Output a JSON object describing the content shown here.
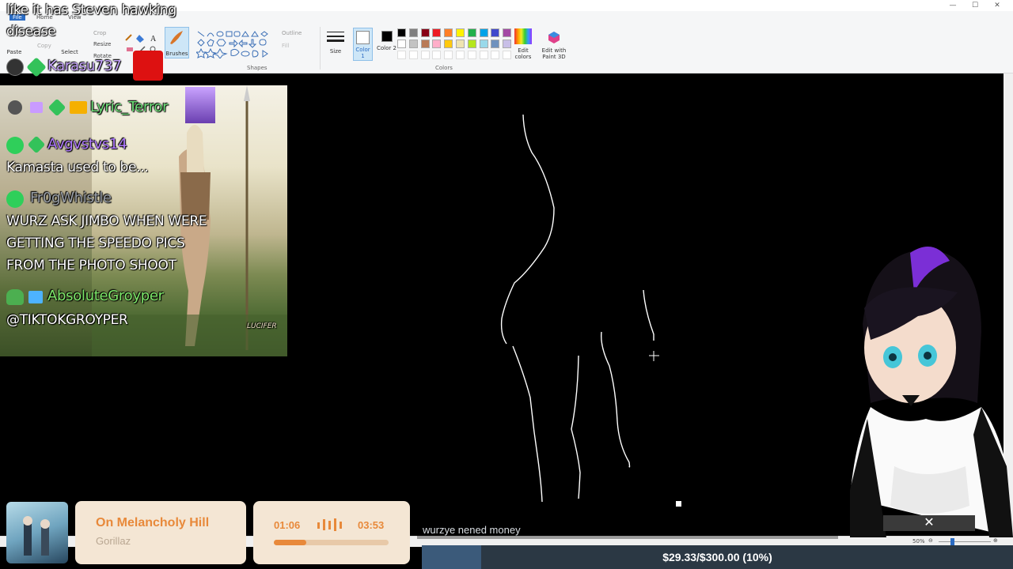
{
  "window": {
    "minimize": "—",
    "maximize": "☐",
    "close": "✕"
  },
  "ribbon": {
    "tab_file": "File",
    "tab_home": "Home",
    "tab_view": "View",
    "paste": "Paste",
    "copy": "Copy",
    "select": "Select",
    "crop": "Crop",
    "resize": "Resize",
    "rotate": "Rotate",
    "brushes": "Brushes",
    "outline": "Outline",
    "fill": "Fill",
    "shapes_group": "Shapes",
    "size": "Size",
    "color1": "Color 1",
    "color2": "Color 2",
    "colors_group": "Colors",
    "edit_colors": "Edit colors",
    "edit_paint3d": "Edit with Paint 3D",
    "palette_row1": [
      "#000000",
      "#7f7f7f",
      "#880015",
      "#ed1c24",
      "#ff7f27",
      "#fff200",
      "#22b14c",
      "#00a2e8",
      "#3f48cc",
      "#a349a4"
    ],
    "palette_row2": [
      "#ffffff",
      "#c3c3c3",
      "#b97a57",
      "#ffaec9",
      "#ffc90e",
      "#efe4b0",
      "#b5e61d",
      "#99d9ea",
      "#7092be",
      "#c8bfe7"
    ]
  },
  "statusbar": {
    "zoom": "50%",
    "zoom_out": "⊖",
    "zoom_in": "⊕"
  },
  "chat": {
    "top_msg_line1": "like it has Steven hawking",
    "top_msg_line2": "disease",
    "user1": "Karasu737",
    "user2": "Lyric_Terror",
    "user3": "Avgvstvs14",
    "msg3": "Kamasta used to be...",
    "user4": "Fr0gWhistle",
    "msg4_line1": "WURZ ASK JIMBO WHEN WERE",
    "msg4_line2": "GETTING THE SPEEDO PICS",
    "msg4_line3": "FROM THE PHOTO SHOOT",
    "user5": "AbsoluteGroyper",
    "msg5": "@TIKTOKGROYPER"
  },
  "art_card": {
    "logo": "LUCIFER"
  },
  "music": {
    "title": "On Melancholy Hill",
    "artist": "Gorillaz",
    "elapsed": "01:06",
    "total": "03:53",
    "progress": 0.28
  },
  "ticker": {
    "text": "wurzye nened money"
  },
  "goal": {
    "text": "$29.33/$300.00 (10%)",
    "fraction": 0.1
  }
}
